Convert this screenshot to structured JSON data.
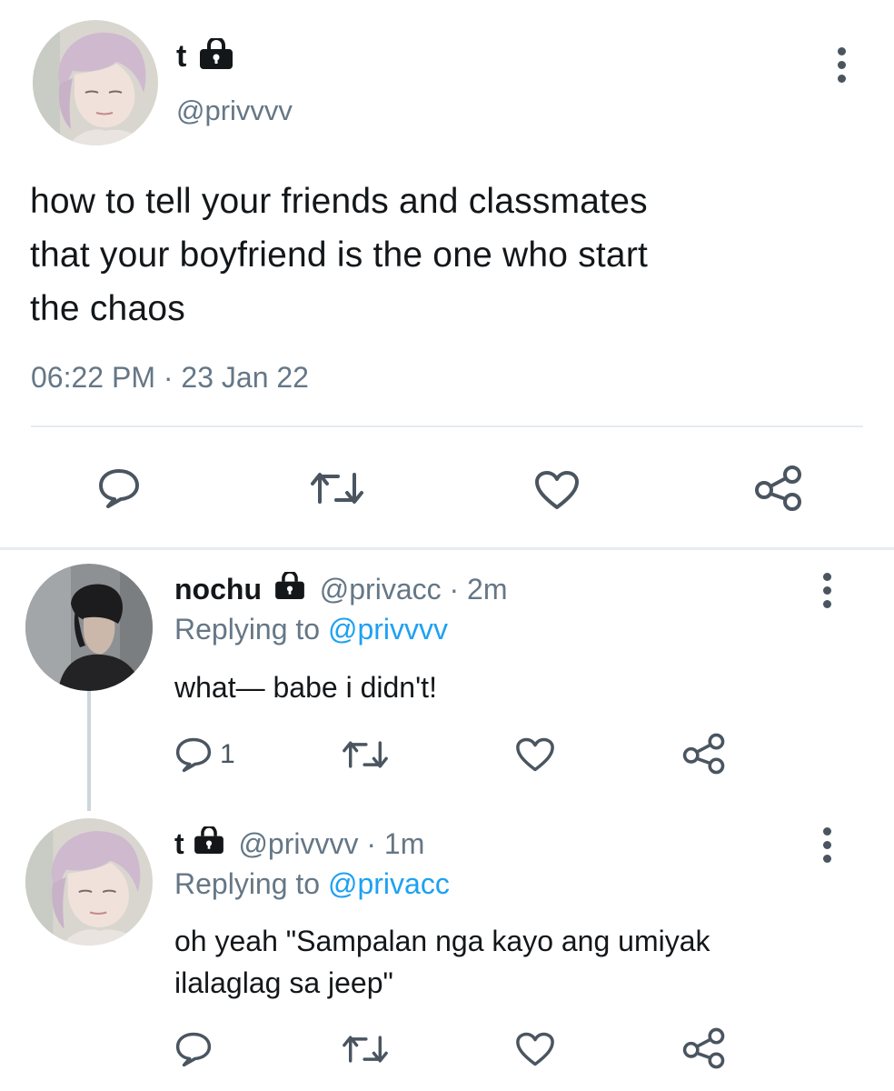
{
  "main_tweet": {
    "display_name": "t",
    "handle": "@privvvv",
    "text_lines": [
      "how to tell your friends and classmates",
      "that your boyfriend is the one who start",
      "the chaos"
    ],
    "timestamp": "06:22 PM · 23 Jan 22"
  },
  "replies": [
    {
      "display_name": "nochu",
      "handle": "@privacc",
      "time": "· 2m",
      "replying_label": "Replying to",
      "replying_handle": "@privvvv",
      "text_lines": [
        "what— babe i didn't!"
      ],
      "reply_count": "1"
    },
    {
      "display_name": "t",
      "handle": "@privvvv",
      "time": "· 1m",
      "replying_label": "Replying to",
      "replying_handle": "@privacc",
      "text_lines": [
        "oh yeah \"Sampalan nga kayo ang umiyak",
        "ilalaglag sa jeep\""
      ],
      "reply_count": ""
    }
  ],
  "icons": {
    "reply": "reply-icon",
    "retweet": "retweet-icon",
    "like": "heart-icon",
    "share": "share-icon",
    "lock": "lock-icon",
    "more": "more-vertical-icon"
  },
  "colors": {
    "text": "#14171a",
    "secondary": "#657786",
    "link": "#1da1f2",
    "divider": "#e6ecf0"
  }
}
